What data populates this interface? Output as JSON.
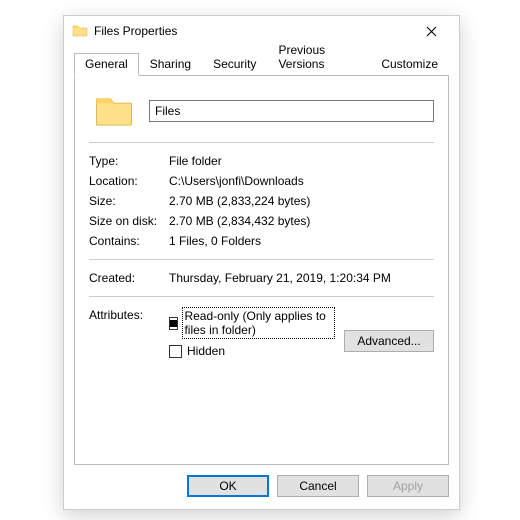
{
  "title": "Files Properties",
  "tabs": [
    "General",
    "Sharing",
    "Security",
    "Previous Versions",
    "Customize"
  ],
  "name_value": "Files",
  "rows": {
    "type_label": "Type:",
    "type_value": "File folder",
    "location_label": "Location:",
    "location_value": "C:\\Users\\jonfi\\Downloads",
    "size_label": "Size:",
    "size_value": "2.70 MB (2,833,224 bytes)",
    "disk_label": "Size on disk:",
    "disk_value": "2.70 MB (2,834,432 bytes)",
    "contains_label": "Contains:",
    "contains_value": "1 Files, 0 Folders",
    "created_label": "Created:",
    "created_value": "Thursday, February 21, 2019, 1:20:34 PM",
    "attributes_label": "Attributes:"
  },
  "attributes": {
    "readonly_label": "Read-only (Only applies to files in folder)",
    "hidden_label": "Hidden",
    "advanced_label": "Advanced..."
  },
  "buttons": {
    "ok": "OK",
    "cancel": "Cancel",
    "apply": "Apply"
  }
}
